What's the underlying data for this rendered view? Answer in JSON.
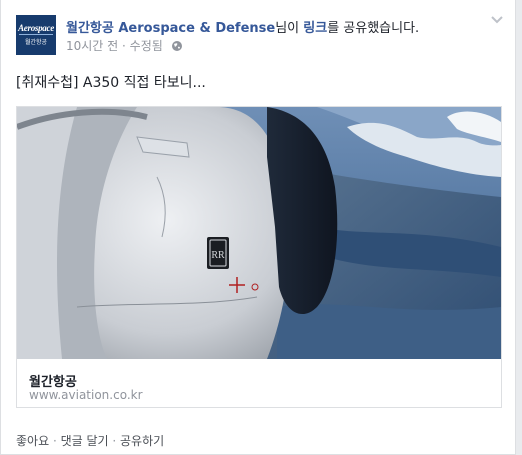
{
  "post": {
    "page_logo_text": "Aerospace",
    "page_logo_sub": "월간항공",
    "author": "월간항공 Aerospace & Defense",
    "shared_mid": "님이 ",
    "shared_link": "링크",
    "shared_end": "를 공유했습니다.",
    "time": "10시간 전",
    "separator": " · ",
    "edited": "수정됨",
    "text": "[취재수첩] A350 직접 타보니...",
    "attachment": {
      "title": "월간항공",
      "url": "www.aviation.co.kr"
    },
    "actions": {
      "like": "좋아요",
      "comment": "댓글 달기",
      "share": "공유하기",
      "sep": " · "
    }
  },
  "icons": {
    "privacy": "globe-icon",
    "menu": "chevron-down-icon"
  },
  "colors": {
    "link": "#365899",
    "meta": "#90949c",
    "logo_bg": "#173b6d"
  }
}
